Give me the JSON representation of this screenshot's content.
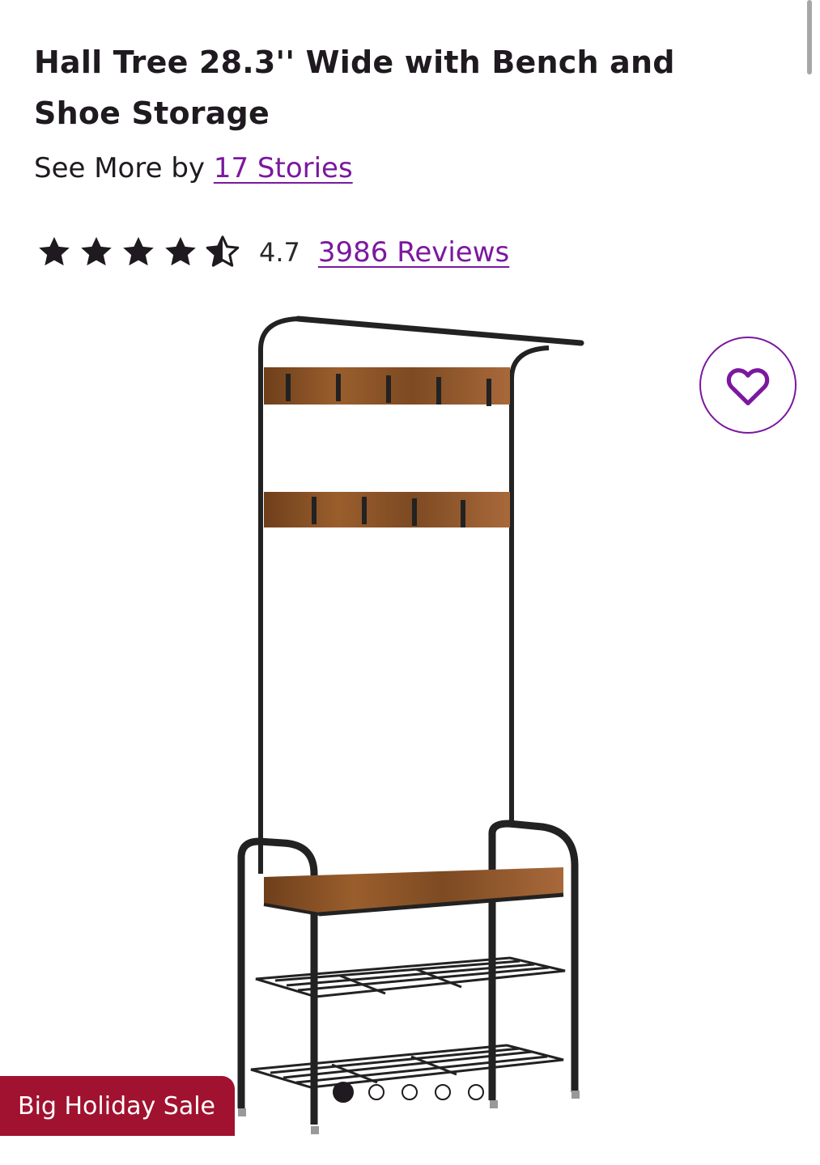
{
  "product": {
    "title": "Hall Tree 28.3'' Wide with Bench and Shoe Storage",
    "see_more_prefix": "See More by",
    "brand": "17 Stories"
  },
  "rating": {
    "value": "4.7",
    "stars": 4.7,
    "reviews": "3986 Reviews"
  },
  "image": {
    "subject": "hall tree with bench and shoe storage"
  },
  "favorite": {
    "icon": "heart-icon"
  },
  "promo": {
    "label": "Big Holiday Sale"
  },
  "carousel": {
    "total": 5,
    "active_index": 0
  },
  "colors": {
    "accent": "#7b189f",
    "sale": "#a0122f",
    "text": "#1f1a1f"
  }
}
